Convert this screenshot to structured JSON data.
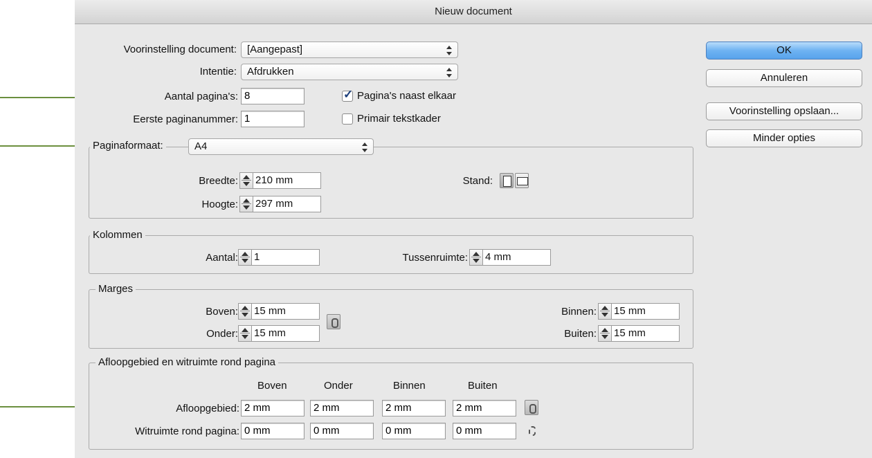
{
  "window": {
    "title": "Nieuw document"
  },
  "preset": {
    "label": "Voorinstelling document:",
    "value": "[Aangepast]"
  },
  "intent": {
    "label": "Intentie:",
    "value": "Afdrukken"
  },
  "pages": {
    "label": "Aantal pagina's:",
    "value": "8"
  },
  "start_page": {
    "label": "Eerste paginanummer:",
    "value": "1"
  },
  "facing_pages": {
    "label": "Pagina's naast elkaar",
    "checked": true
  },
  "primary_frame": {
    "label": "Primair tekstkader",
    "checked": false
  },
  "page_size": {
    "label": "Paginaformaat:",
    "value": "A4",
    "width_label": "Breedte:",
    "width": "210 mm",
    "height_label": "Hoogte:",
    "height": "297 mm",
    "orientation_label": "Stand:"
  },
  "columns": {
    "title": "Kolommen",
    "count_label": "Aantal:",
    "count": "1",
    "gutter_label": "Tussenruimte:",
    "gutter": "4 mm"
  },
  "margins": {
    "title": "Marges",
    "top_label": "Boven:",
    "top": "15 mm",
    "bottom_label": "Onder:",
    "bottom": "15 mm",
    "inside_label": "Binnen:",
    "inside": "15 mm",
    "outside_label": "Buiten:",
    "outside": "15 mm"
  },
  "bleed": {
    "title": "Afloopgebied en witruimte rond pagina",
    "col_top": "Boven",
    "col_bottom": "Onder",
    "col_inside": "Binnen",
    "col_outside": "Buiten",
    "bleed_label": "Afloopgebied:",
    "bleed_values": [
      "2 mm",
      "2 mm",
      "2 mm",
      "2 mm"
    ],
    "slug_label": "Witruimte rond pagina:",
    "slug_values": [
      "0 mm",
      "0 mm",
      "0 mm",
      "0 mm"
    ]
  },
  "buttons": {
    "ok": "OK",
    "cancel": "Annuleren",
    "save_preset": "Voorinstelling opslaan...",
    "fewer_options": "Minder opties"
  },
  "colors": {
    "annotation_arrow": "#6b8f3e",
    "default_button": "#6fb3f2"
  }
}
